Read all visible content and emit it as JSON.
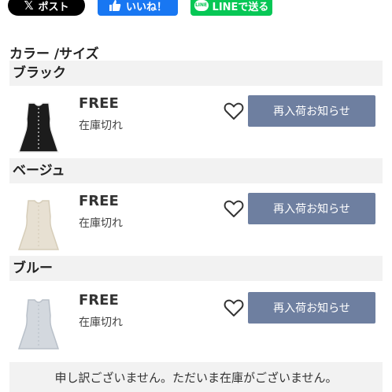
{
  "share": {
    "x_label": "ポスト",
    "facebook_label": "いいね！",
    "line_label": "LINEで送る",
    "line_bubble_text": "LINE"
  },
  "section_title": "カラー /サイズ",
  "variants": [
    {
      "color_name": "ブラック",
      "size": "FREE",
      "stock": "在庫切れ",
      "restock_button": "再入荷お知らせ",
      "dress_color": "#1c1c1c",
      "trim_color": "#ececec"
    },
    {
      "color_name": "ベージュ",
      "size": "FREE",
      "stock": "在庫切れ",
      "restock_button": "再入荷お知らせ",
      "dress_color": "#e7e0d2",
      "trim_color": "#d6cdb9"
    },
    {
      "color_name": "ブルー",
      "size": "FREE",
      "stock": "在庫切れ",
      "restock_button": "再入荷お知らせ",
      "dress_color": "#d3d8de",
      "trim_color": "#b9c0c9"
    }
  ],
  "notice": "申し訳ございません。ただいま在庫がございません。",
  "colors": {
    "x_bg": "#000000",
    "facebook_bg": "#1877f2",
    "line_bg": "#06c755",
    "restock_button_bg": "#6e7fa0",
    "header_bg": "#f2f2f2"
  }
}
